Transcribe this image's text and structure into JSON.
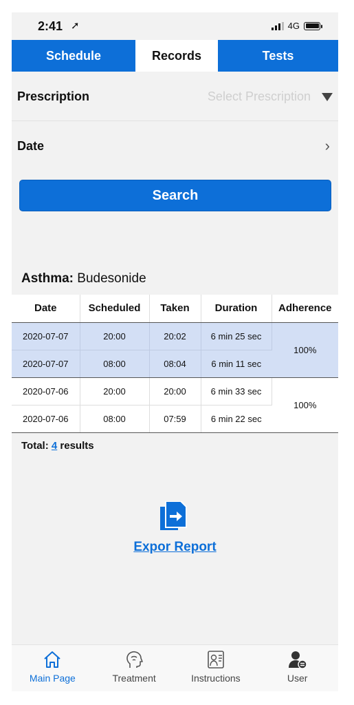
{
  "status": {
    "time": "2:41",
    "location_glyph": "➚",
    "network": "4G"
  },
  "tabs": [
    {
      "label": "Schedule"
    },
    {
      "label": "Records"
    },
    {
      "label": "Tests"
    }
  ],
  "form": {
    "prescription_label": "Prescription",
    "prescription_placeholder": "Select Prescription",
    "date_label": "Date"
  },
  "search_label": "Search",
  "drug": {
    "condition": "Asthma:",
    "name": "Budesonide"
  },
  "table": {
    "headers": [
      "Date",
      "Scheduled",
      "Taken",
      "Duration",
      "Adherence"
    ],
    "groups": [
      {
        "adherence": "100%",
        "rows": [
          {
            "date": "2020-07-07",
            "scheduled": "20:00",
            "taken": "20:02",
            "duration": "6 min 25 sec"
          },
          {
            "date": "2020-07-07",
            "scheduled": "08:00",
            "taken": "08:04",
            "duration": "6 min 11 sec"
          }
        ]
      },
      {
        "adherence": "100%",
        "rows": [
          {
            "date": "2020-07-06",
            "scheduled": "20:00",
            "taken": "20:00",
            "duration": "6 min 33 sec"
          },
          {
            "date": "2020-07-06",
            "scheduled": "08:00",
            "taken": "07:59",
            "duration": "6 min 22 sec"
          }
        ]
      }
    ]
  },
  "total": {
    "prefix": "Total:",
    "count": "4",
    "suffix": "results"
  },
  "export_label": "Expor Report",
  "nav": [
    {
      "label": "Main Page",
      "icon": "home-icon"
    },
    {
      "label": "Treatment",
      "icon": "head-icon"
    },
    {
      "label": "Instructions",
      "icon": "instructions-icon"
    },
    {
      "label": "User",
      "icon": "user-icon"
    }
  ],
  "colors": {
    "accent": "#0d6fd8",
    "highlight_row": "#d3dff5"
  }
}
